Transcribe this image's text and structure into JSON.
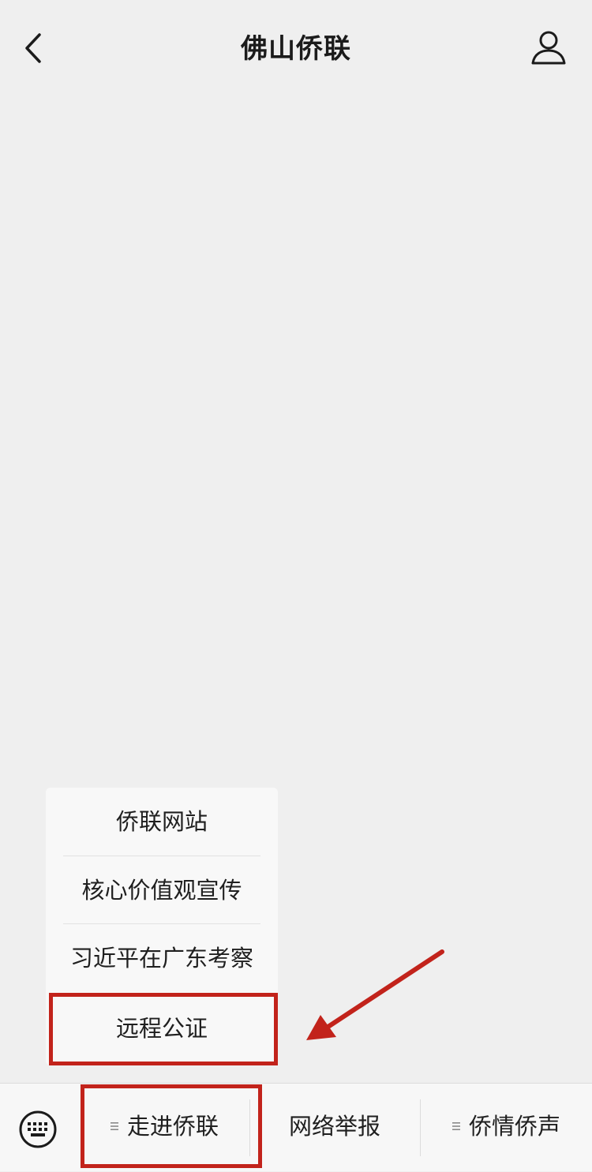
{
  "header": {
    "title": "佛山侨联",
    "back_icon": "chevron-left-icon",
    "profile_icon": "person-icon"
  },
  "submenu": {
    "items": [
      {
        "label": "侨联网站"
      },
      {
        "label": "核心价值观宣传"
      },
      {
        "label": "习近平在广东考察"
      },
      {
        "label": "远程公证"
      }
    ]
  },
  "bottom_menu": {
    "keyboard_icon": "keyboard-icon",
    "tabs": [
      {
        "label": "走进侨联",
        "has_submenu": true
      },
      {
        "label": "网络举报",
        "has_submenu": false
      },
      {
        "label": "侨情侨声",
        "has_submenu": true
      }
    ]
  },
  "colors": {
    "background": "#efefef",
    "menu_background": "#f7f7f7",
    "highlight": "#c2231b",
    "text": "#1b1b1b"
  }
}
